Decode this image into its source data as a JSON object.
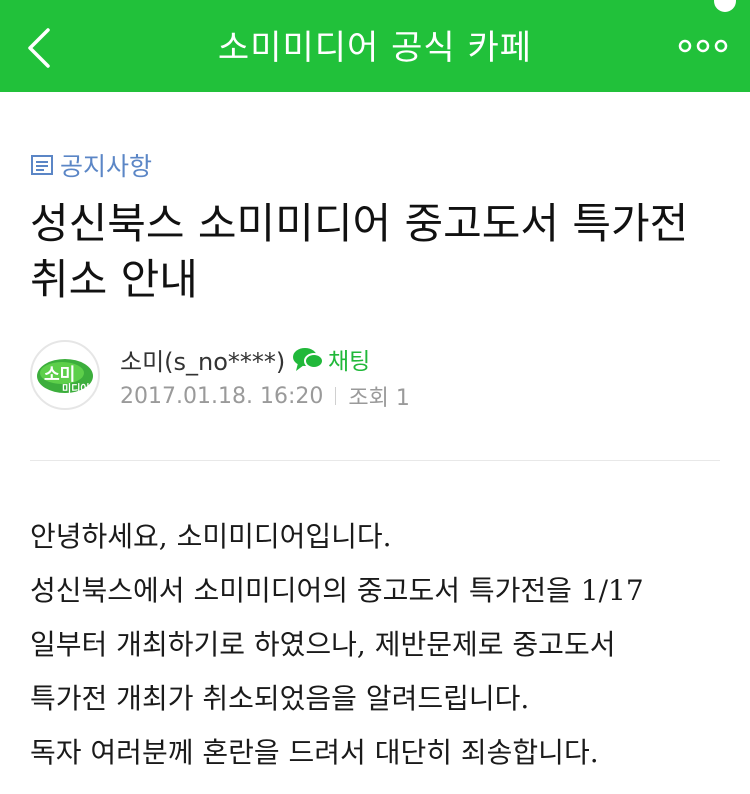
{
  "header": {
    "title": "소미미디어 공식 카페",
    "back_icon": "chevron-left-icon",
    "more_icon": "more-dots-icon",
    "bg_color": "#21c13a"
  },
  "post": {
    "category": "공지사항",
    "title": "성신북스 소미미디어 중고도서 특가전 취소 안내",
    "author": {
      "name": "소미(s_no****)",
      "avatar_text_top": "소미",
      "avatar_text_bottom": "미디어",
      "chat_label": "채팅"
    },
    "date": "2017.01.18. 16:20",
    "views_label": "조회 1",
    "body_lines": [
      "안녕하세요, 소미미디어입니다.",
      "성신북스에서 소미미디어의 중고도서 특가전을 1/17",
      "일부터 개최하기로 하였으나, 제반문제로 중고도서",
      "특가전 개최가 취소되었음을 알려드립니다.",
      "독자 여러분께 혼란을 드려서 대단히 죄송합니다."
    ]
  }
}
